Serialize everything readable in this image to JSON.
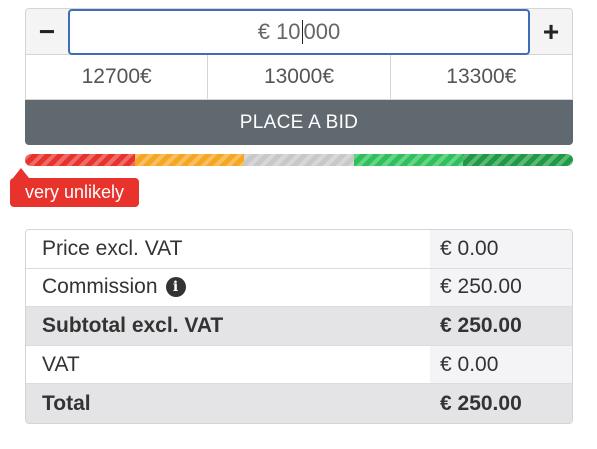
{
  "bid": {
    "decrement_symbol": "−",
    "increment_symbol": "+",
    "amount_before_caret": "€ 10",
    "amount_after_caret": "000",
    "quick_bids": [
      "12700€",
      "13000€",
      "13300€"
    ],
    "place_bid_label": "PLACE A BID"
  },
  "likelihood": {
    "label": "very unlikely",
    "segment_colors": [
      "#e8322c",
      "#f5a623",
      "#c8c8c8",
      "#2ec05a",
      "#1e9a44"
    ]
  },
  "summary": {
    "rows": [
      {
        "label": "Price excl. VAT",
        "value": "€ 0.00"
      },
      {
        "label": "Commission",
        "value": "€ 250.00"
      },
      {
        "label": "Subtotal excl. VAT",
        "value": "€ 250.00"
      },
      {
        "label": "VAT",
        "value": "€ 0.00"
      },
      {
        "label": "Total",
        "value": "€ 250.00"
      }
    ],
    "info_icon_glyph": "i"
  }
}
